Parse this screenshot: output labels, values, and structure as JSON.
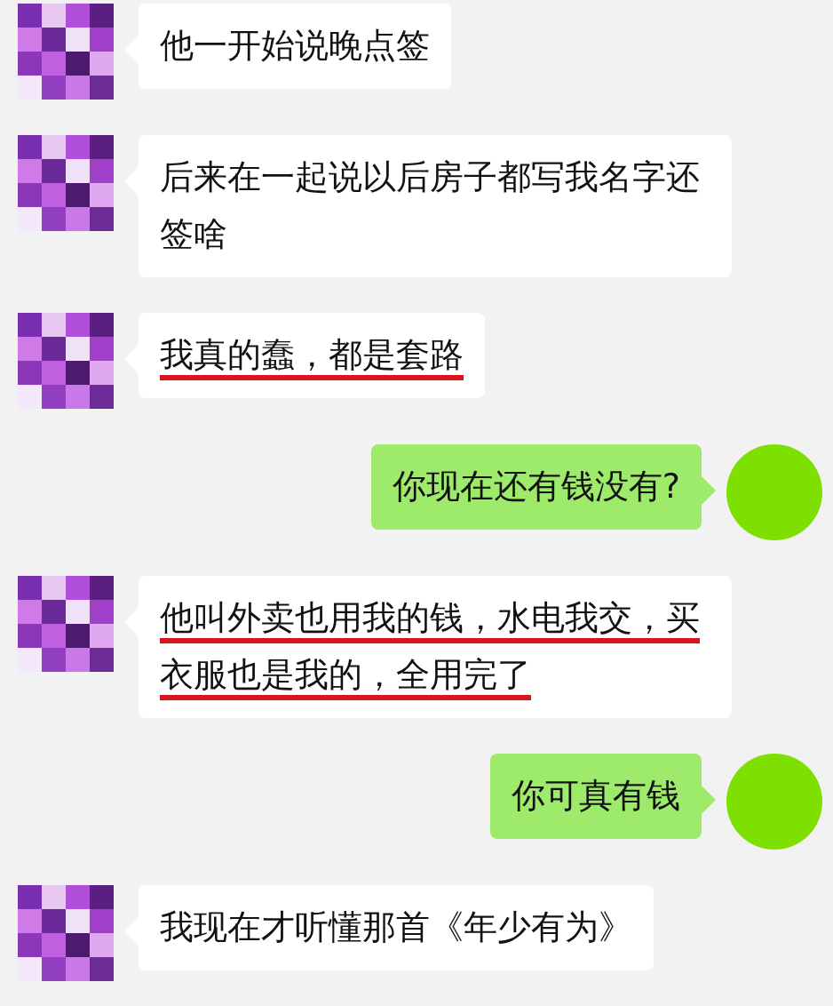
{
  "messages": [
    {
      "kind": "received",
      "text": "他一开始说晚点签",
      "underlined": false
    },
    {
      "kind": "received",
      "text": "后来在一起说以后房子都写我名字还签啥",
      "underlined": false
    },
    {
      "kind": "received",
      "text": "我真的蠢，都是套路",
      "underlined": true
    },
    {
      "kind": "sent",
      "text": "你现在还有钱没有?",
      "underlined": false
    },
    {
      "kind": "received",
      "text": "他叫外卖也用我的钱，水电我交，买衣服也是我的，全用完了",
      "underlined": true
    },
    {
      "kind": "sent",
      "text": "你可真有钱",
      "underlined": false
    },
    {
      "kind": "received",
      "text": "我现在才听懂那首《年少有为》",
      "underlined": false
    }
  ]
}
